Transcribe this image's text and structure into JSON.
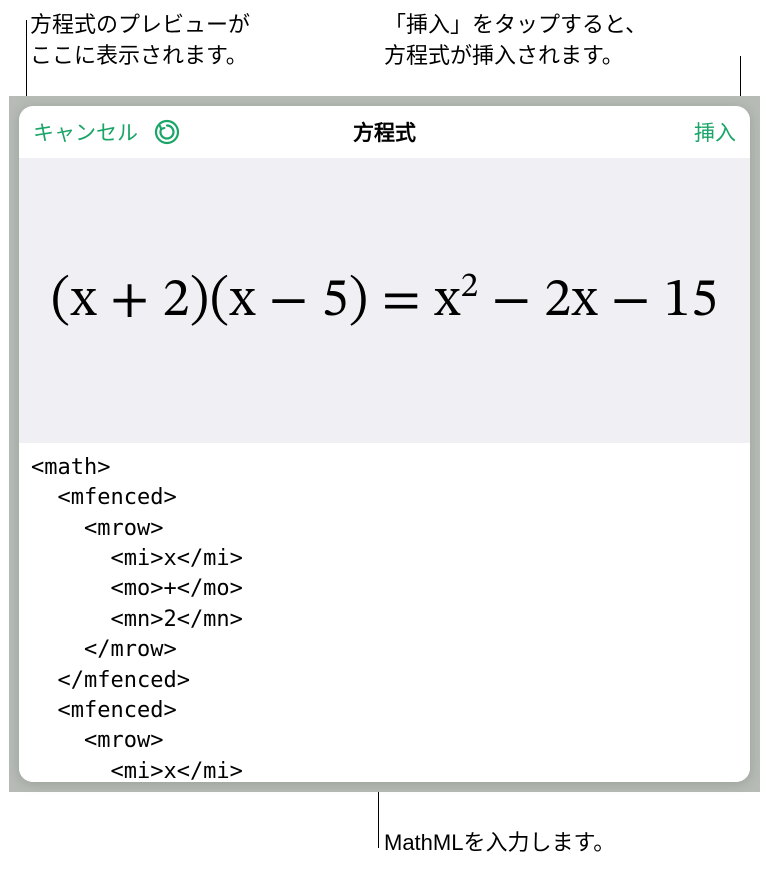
{
  "callouts": {
    "preview_hint": "方程式のプレビューが\nここに表示されます。",
    "insert_hint": "「挿入」をタップすると、\n方程式が挿入されます。",
    "code_hint": "MathMLを入力します。"
  },
  "header": {
    "cancel_label": "キャンセル",
    "title": "方程式",
    "insert_label": "挿入"
  },
  "icons": {
    "undo": "undo-icon"
  },
  "colors": {
    "accent": "#1aa568",
    "preview_bg": "#f0f0f4",
    "frame_bg": "#b6bbb5"
  },
  "equation_preview_html": "(x + 2)(x − 5) = x<sup>2</sup> − 2x − 15",
  "mathml_code": "<math>\n  <mfenced>\n    <mrow>\n      <mi>x</mi>\n      <mo>+</mo>\n      <mn>2</mn>\n    </mrow>\n  </mfenced>\n  <mfenced>\n    <mrow>\n      <mi>x</mi>\n"
}
